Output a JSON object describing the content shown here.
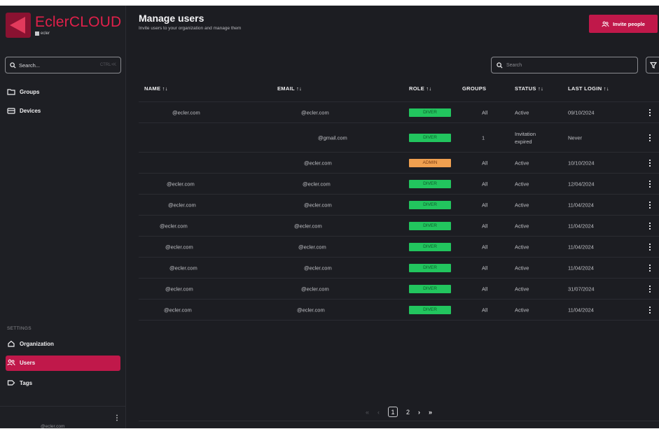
{
  "app": {
    "logo_title": "EclerCLOUD",
    "logo_sub": "ecler"
  },
  "sidebar": {
    "search_placeholder": "Search...",
    "search_shortcut": "CTRL+K",
    "items": [
      {
        "label": "Groups",
        "icon": "folder-icon"
      },
      {
        "label": "Devices",
        "icon": "devices-icon"
      }
    ],
    "settings_label": "SETTINGS",
    "settings_items": [
      {
        "label": "Organization",
        "icon": "home-icon"
      },
      {
        "label": "Users",
        "icon": "users-icon",
        "active": true
      },
      {
        "label": "Tags",
        "icon": "tag-icon"
      }
    ],
    "footer_email": "@ecler.com"
  },
  "header": {
    "title": "Manage users",
    "subtitle": "Invite users to your organization and manage them",
    "invite_label": "Invite people"
  },
  "toolbar": {
    "search_placeholder": "Search"
  },
  "table": {
    "columns": [
      {
        "label": "NAME ↑↓",
        "sortable": true
      },
      {
        "label": "EMAIL ↑↓",
        "sortable": true
      },
      {
        "label": "ROLE ↑↓",
        "sortable": true
      },
      {
        "label": "GROUPS",
        "sortable": false
      },
      {
        "label": "STATUS ↑↓",
        "sortable": true
      },
      {
        "label": "LAST LOGIN ↑↓",
        "sortable": true
      }
    ],
    "rows": [
      {
        "name": "@ecler.com",
        "email": "@ecler.com",
        "role": "DIVER",
        "groups": "All",
        "status": "Active",
        "last_login": "09/10/2024"
      },
      {
        "name": "",
        "email": "@gmail.com",
        "role": "DIVER",
        "groups": "1",
        "status": "Invitation expired",
        "status_line1": "Invitation",
        "status_line2": "expired",
        "last_login": "Never"
      },
      {
        "name": "",
        "email": "@ecler.com",
        "role": "ADMIN",
        "groups": "All",
        "status": "Active",
        "last_login": "10/10/2024"
      },
      {
        "name": "@ecler.com",
        "email": "@ecler.com",
        "role": "DIVER",
        "groups": "All",
        "status": "Active",
        "last_login": "12/04/2024"
      },
      {
        "name": "@ecler.com",
        "email": "@ecler.com",
        "role": "DIVER",
        "groups": "All",
        "status": "Active",
        "last_login": "11/04/2024"
      },
      {
        "name": "@ecler.com",
        "email": "@ecler.com",
        "role": "DIVER",
        "groups": "All",
        "status": "Active",
        "last_login": "11/04/2024"
      },
      {
        "name": "@ecler.com",
        "email": "@ecler.com",
        "role": "DIVER",
        "groups": "All",
        "status": "Active",
        "last_login": "11/04/2024"
      },
      {
        "name": "@ecler.com",
        "email": "@ecler.com",
        "role": "DIVER",
        "groups": "All",
        "status": "Active",
        "last_login": "11/04/2024"
      },
      {
        "name": "@ecler.com",
        "email": "@ecler.com",
        "role": "DIVER",
        "groups": "All",
        "status": "Active",
        "last_login": "31/07/2024"
      },
      {
        "name": "@ecler.com",
        "email": "@ecler.com",
        "role": "DIVER",
        "groups": "All",
        "status": "Active",
        "last_login": "11/04/2024"
      }
    ]
  },
  "pagination": {
    "first": "«",
    "prev": "‹",
    "current": "1",
    "next_page": "2",
    "next": "›",
    "last": "»"
  },
  "colors": {
    "accent": "#c0184a",
    "diver_badge": "#22c55e",
    "admin_badge": "#f0a050",
    "background": "#1c1d22"
  }
}
